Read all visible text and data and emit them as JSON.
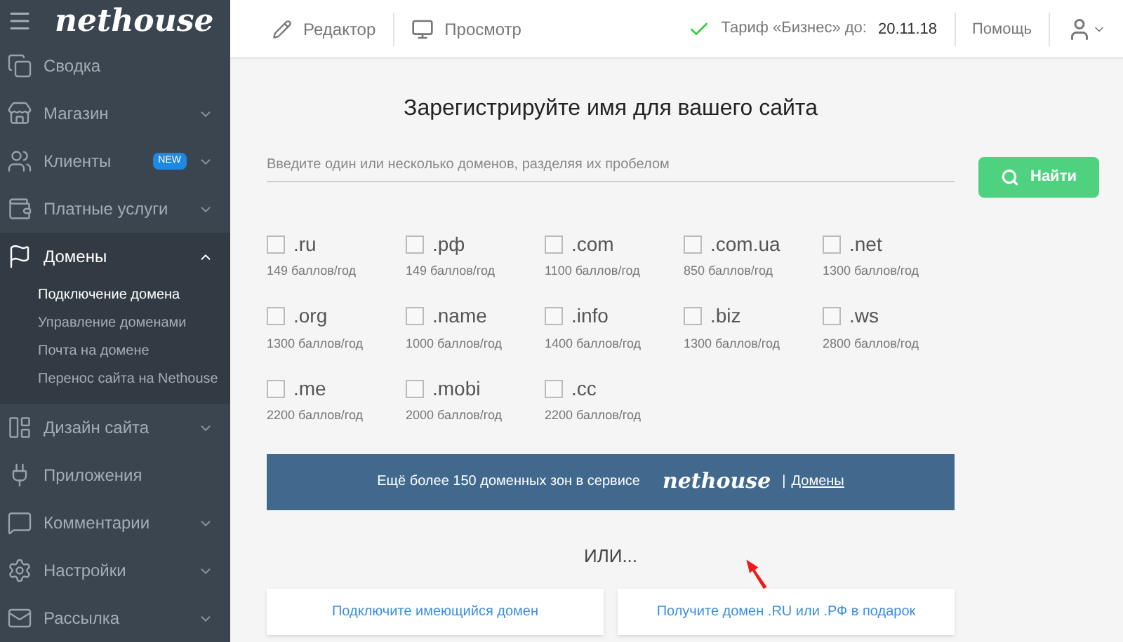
{
  "sidebar": {
    "logo": "nethouse",
    "items": [
      {
        "label": "Сводка",
        "expandable": false,
        "expanded": false
      },
      {
        "label": "Магазин",
        "expandable": true,
        "expanded": false
      },
      {
        "label": "Клиенты",
        "badge": "NEW",
        "expandable": true,
        "expanded": false
      },
      {
        "label": "Платные услуги",
        "expandable": true,
        "expanded": false
      },
      {
        "label": "Домены",
        "expandable": true,
        "expanded": true,
        "children": [
          {
            "label": "Подключение домена",
            "selected": true
          },
          {
            "label": "Управление доменами",
            "selected": false
          },
          {
            "label": "Почта на домене",
            "selected": false
          },
          {
            "label": "Перенос сайта на Nethouse",
            "selected": false
          }
        ]
      },
      {
        "label": "Дизайн сайта",
        "expandable": true,
        "expanded": false
      },
      {
        "label": "Приложения",
        "expandable": false,
        "expanded": false
      },
      {
        "label": "Комментарии",
        "expandable": true,
        "expanded": false
      },
      {
        "label": "Настройки",
        "expandable": true,
        "expanded": false
      },
      {
        "label": "Рассылка",
        "expandable": true,
        "expanded": false
      }
    ]
  },
  "topbar": {
    "editor": "Редактор",
    "preview": "Просмотр",
    "plan": "Тариф «Бизнес» до:",
    "plan_date": "20.11.18",
    "help": "Помощь"
  },
  "main": {
    "title": "Зарегистрируйте имя для вашего сайта",
    "search": {
      "placeholder": "Введите один или несколько доменов, разделяя их пробелом",
      "button": "Найти"
    },
    "domains": [
      {
        "zone": ".ru",
        "price": "149 баллов/год",
        "checked": false
      },
      {
        "zone": ".рф",
        "price": "149 баллов/год",
        "checked": false
      },
      {
        "zone": ".com",
        "price": "1100 баллов/год",
        "checked": false
      },
      {
        "zone": ".com.ua",
        "price": "850 баллов/год",
        "checked": false
      },
      {
        "zone": ".net",
        "price": "1300 баллов/год",
        "checked": false
      },
      {
        "zone": ".org",
        "price": "1300 баллов/год",
        "checked": false
      },
      {
        "zone": ".name",
        "price": "1000 баллов/год",
        "checked": false
      },
      {
        "zone": ".info",
        "price": "1400 баллов/год",
        "checked": false
      },
      {
        "zone": ".biz",
        "price": "1300 баллов/год",
        "checked": false
      },
      {
        "zone": ".ws",
        "price": "2800 баллов/год",
        "checked": false
      },
      {
        "zone": ".me",
        "price": "2200 баллов/год",
        "checked": false
      },
      {
        "zone": ".mobi",
        "price": "2000 баллов/год",
        "checked": false
      },
      {
        "zone": ".cc",
        "price": "2200 баллов/год",
        "checked": false
      }
    ],
    "banner": {
      "text": "Ещё более 150 доменных зон в сервисе",
      "logo": "nethouse",
      "separator": "|",
      "link": "Домены"
    },
    "or": "ИЛИ...",
    "actions": [
      "Подключите имеющийся домен",
      "Получите домен .RU или .РФ в подарок"
    ]
  }
}
